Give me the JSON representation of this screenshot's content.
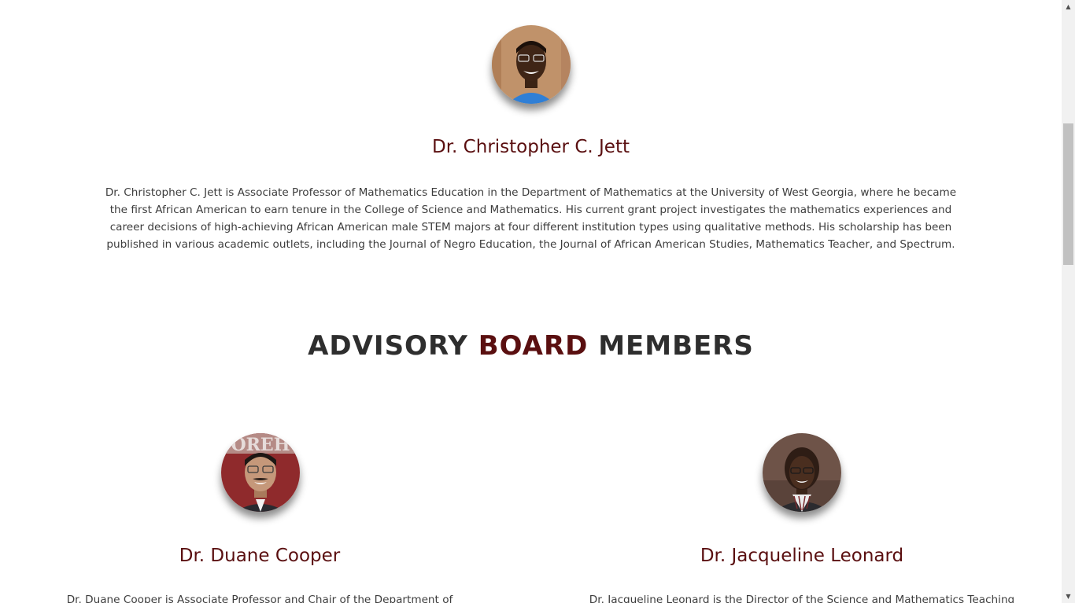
{
  "featured": {
    "name": "Dr. Christopher C. Jett",
    "bio": "Dr. Christopher C. Jett is Associate Professor of Mathematics Education in the Department of Mathematics at the University of West Georgia, where he became the first African American to earn tenure in the College of Science and Mathematics. His current grant project investigates the mathematics experiences and career decisions of high-achieving African American male STEM majors at four different institution types using qualitative methods. His scholarship has been published in various academic outlets, including the Journal of Negro Education, the Journal of African American Studies, Mathematics Teacher, and Spectrum."
  },
  "section": {
    "title_part1": "ADVISORY",
    "title_accent": "BOARD",
    "title_part2": "MEMBERS"
  },
  "members": [
    {
      "name": "Dr. Duane Cooper",
      "bio": "Dr. Duane Cooper is Associate Professor and Chair of the Department of"
    },
    {
      "name": "Dr. Jacqueline Leonard",
      "bio": "Dr. Jacqueline Leonard is the Director of the Science and Mathematics Teaching"
    }
  ],
  "colors": {
    "accent": "#5a0f10",
    "heading": "#2e2e2e",
    "body_text": "#3d3d3d",
    "scrollbar_track": "#f1f1f1",
    "scrollbar_thumb": "#c1c1c1"
  },
  "scrollbar": {
    "up_icon": "triangle-up",
    "down_icon": "triangle-down"
  }
}
